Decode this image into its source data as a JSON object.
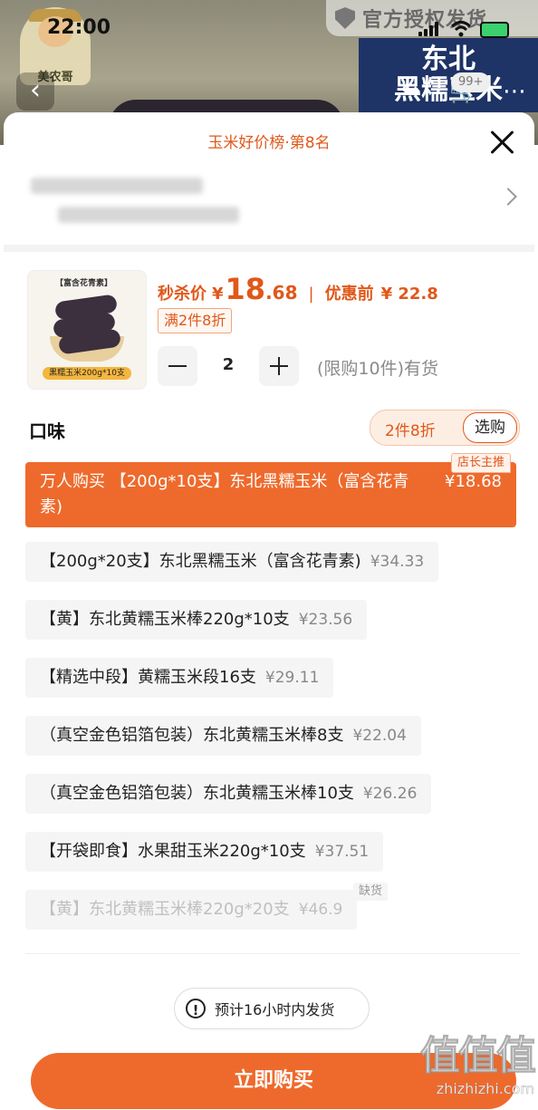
{
  "status_bar": {
    "time": "22:00"
  },
  "backdrop": {
    "brand_name": "美农哥",
    "auth_banner": "官方授权发货",
    "product_title_lines": [
      "东北",
      "黑糯玉米"
    ],
    "cart_badge": "99+"
  },
  "sheet": {
    "rank_title": "玉米好价榜·第8名",
    "thumbnail": {
      "top_tag": "【富含花青素】",
      "bottom_tag": "黑糯玉米200g*10支"
    },
    "price": {
      "flash_label": "秒杀价",
      "currency": "¥",
      "flash_int": "18",
      "flash_dec": ".68",
      "divider": "|",
      "before_label": "优惠前",
      "before_value": "¥ 22.8"
    },
    "discount_tag": "满2件8折",
    "quantity": "2",
    "limit_text": "(限购10件)有货",
    "flavor_title": "口味",
    "promo": {
      "text": "2件8折",
      "button": "选购"
    },
    "options": [
      {
        "name": "万人购买 【200g*10支】东北黑糯玉米（富含花青素)",
        "price": "¥18.68",
        "tag": "店长主推",
        "state": "selected"
      },
      {
        "name": "【200g*20支】东北黑糯玉米（富含花青素)",
        "price": "¥34.33",
        "state": "normal"
      },
      {
        "name": "【黄】东北黄糯玉米棒220g*10支",
        "price": "¥23.56",
        "state": "normal"
      },
      {
        "name": "【精选中段】黄糯玉米段16支",
        "price": "¥29.11",
        "state": "normal"
      },
      {
        "name": "（真空金色铝箔包装）东北黄糯玉米棒8支",
        "price": "¥22.04",
        "state": "normal"
      },
      {
        "name": "（真空金色铝箔包装）东北黄糯玉米棒10支",
        "price": "¥26.26",
        "state": "normal"
      },
      {
        "name": "【开袋即食】水果甜玉米220g*10支",
        "price": "¥37.51",
        "state": "normal"
      },
      {
        "name": "【黄】东北黄糯玉米棒220g*20支",
        "price": "¥46.9",
        "tag": "缺货",
        "state": "disabled"
      }
    ],
    "shipping_note": "预计16小时内发货",
    "buy_button": "立即购买"
  },
  "watermark": {
    "logo": "值值值",
    "url": "zhizhizhi.com"
  },
  "colors": {
    "accent": "#ee6a2c",
    "accent_text": "#e0581a"
  }
}
